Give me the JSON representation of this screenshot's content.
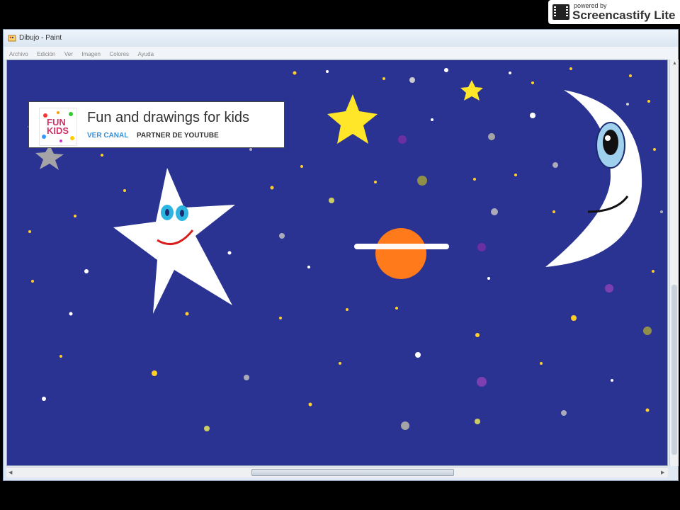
{
  "window": {
    "title": "Dibujo - Paint",
    "menu": [
      "Archivo",
      "Edición",
      "Ver",
      "Imagen",
      "Colores",
      "Ayuda"
    ]
  },
  "overlay": {
    "badge_small": "powered by",
    "badge_big": "Screencastify Lite"
  },
  "channel": {
    "logo_text": "FUN KIDS",
    "title": "Fun and drawings for kids",
    "subscribe": "VER CANAL",
    "partner": "PARTNER DE YOUTUBE"
  },
  "colors": {
    "sky": "#2a3292",
    "star_yellow": "#ffe629",
    "star_white": "#ffffff",
    "star_gray": "#a4a4a6",
    "planet_orange": "#ff7a1a",
    "eye_blue": "#2bb5e0",
    "smile_red": "#d91d1d"
  },
  "icons": [
    "paint-app-icon",
    "screencastify-film-icon",
    "scroll-arrow-icon"
  ]
}
